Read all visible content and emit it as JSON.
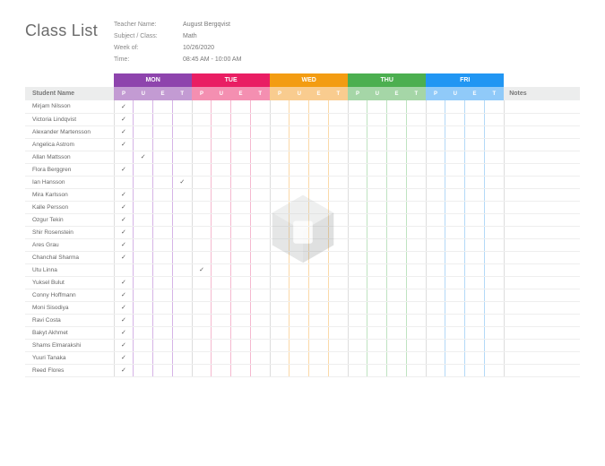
{
  "title": "Class List",
  "meta": {
    "teacher_label": "Teacher Name:",
    "teacher_value": "August Bergqvist",
    "subject_label": "Subject / Class:",
    "subject_value": "Math",
    "week_label": "Week of:",
    "week_value": "10/26/2020",
    "time_label": "Time:",
    "time_value": "08:45 AM - 10:00 AM"
  },
  "columns": {
    "student": "Student Name",
    "notes": "Notes",
    "days": [
      "MON",
      "TUE",
      "WED",
      "THU",
      "FRI"
    ],
    "sub": [
      "P",
      "U",
      "E",
      "T"
    ]
  },
  "students": [
    {
      "name": "Mirjam Nilsson",
      "marks": [
        [
          0,
          0
        ]
      ]
    },
    {
      "name": "Victoria Lindqvist",
      "marks": [
        [
          0,
          0
        ]
      ]
    },
    {
      "name": "Alexander Martensson",
      "marks": [
        [
          0,
          0
        ]
      ]
    },
    {
      "name": "Angelica Astrom",
      "marks": [
        [
          0,
          0
        ]
      ]
    },
    {
      "name": "Allan Mattsson",
      "marks": [
        [
          0,
          1
        ]
      ]
    },
    {
      "name": "Flora Berggren",
      "marks": [
        [
          0,
          0
        ]
      ]
    },
    {
      "name": "Ian Hansson",
      "marks": [
        [
          0,
          3
        ]
      ]
    },
    {
      "name": "Mira Karlsson",
      "marks": [
        [
          0,
          0
        ]
      ]
    },
    {
      "name": "Kalle Persson",
      "marks": [
        [
          0,
          0
        ]
      ]
    },
    {
      "name": "Ozgur Tekin",
      "marks": [
        [
          0,
          0
        ]
      ]
    },
    {
      "name": "Shir Rosenstein",
      "marks": [
        [
          0,
          0
        ]
      ]
    },
    {
      "name": "Ares Grau",
      "marks": [
        [
          0,
          0
        ]
      ]
    },
    {
      "name": "Chanchal Sharma",
      "marks": [
        [
          0,
          0
        ]
      ]
    },
    {
      "name": "Utu Linna",
      "marks": [
        [
          1,
          0
        ]
      ]
    },
    {
      "name": "Yuksel Bulut",
      "marks": [
        [
          0,
          0
        ]
      ]
    },
    {
      "name": "Conny Hoffmann",
      "marks": [
        [
          0,
          0
        ]
      ]
    },
    {
      "name": "Moni Sisodiya",
      "marks": [
        [
          0,
          0
        ]
      ]
    },
    {
      "name": "Ravi Costa",
      "marks": [
        [
          0,
          0
        ]
      ]
    },
    {
      "name": "Bakyt Akhmet",
      "marks": [
        [
          0,
          0
        ]
      ]
    },
    {
      "name": "Shams Elmarakshi",
      "marks": [
        [
          0,
          0
        ]
      ]
    },
    {
      "name": "Yuuri Tanaka",
      "marks": [
        [
          0,
          0
        ]
      ]
    },
    {
      "name": "Reed Flores",
      "marks": [
        [
          0,
          0
        ]
      ]
    }
  ]
}
